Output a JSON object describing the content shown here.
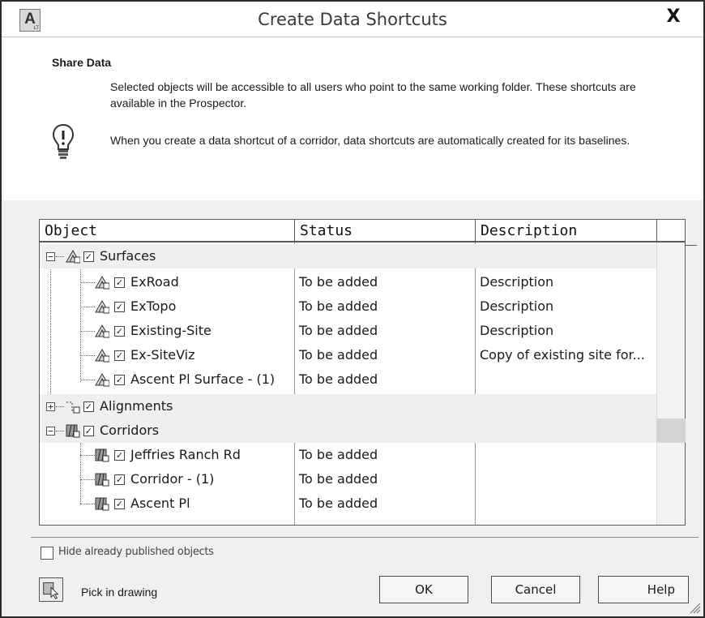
{
  "window": {
    "title": "Create Data Shortcuts",
    "close_label": "X",
    "app_icon_letter": "A",
    "app_icon_sub": "LT"
  },
  "info": {
    "heading": "Share Data",
    "text1": "Selected objects will be accessible to all users who point to the same working folder. These shortcuts are available in the Prospector.",
    "text2": "When you create a data shortcut of a corridor, data shortcuts are automatically created for its baselines.",
    "icon": "lightbulb-icon"
  },
  "grid": {
    "columns": [
      "Object",
      "Status",
      "Description"
    ],
    "rows": [
      {
        "name": "Surfaces",
        "status": "",
        "description": "",
        "group": true,
        "checked": true,
        "icon": "surface-icon"
      },
      {
        "name": "ExRoad",
        "status": "To be added",
        "description": "Description",
        "group": false,
        "checked": true,
        "icon": "surface-icon"
      },
      {
        "name": "ExTopo",
        "status": "To be added",
        "description": "Description",
        "group": false,
        "checked": true,
        "icon": "surface-icon"
      },
      {
        "name": "Existing-Site",
        "status": "To be added",
        "description": "Description",
        "group": false,
        "checked": true,
        "icon": "surface-icon"
      },
      {
        "name": "Ex-SiteViz",
        "status": "To be added",
        "description": "Copy of existing site for...",
        "group": false,
        "checked": true,
        "icon": "surface-icon"
      },
      {
        "name": "Ascent Pl Surface - (1)",
        "status": "To be added",
        "description": "",
        "group": false,
        "checked": true,
        "icon": "surface-icon"
      },
      {
        "name": "Alignments",
        "status": "",
        "description": "",
        "group": true,
        "checked": true,
        "icon": "alignment-icon"
      },
      {
        "name": "Corridors",
        "status": "",
        "description": "",
        "group": true,
        "checked": true,
        "icon": "corridor-icon"
      },
      {
        "name": "Jeffries Ranch Rd",
        "status": "To be added",
        "description": "",
        "group": false,
        "checked": true,
        "icon": "corridor-icon"
      },
      {
        "name": "Corridor - (1)",
        "status": "To be added",
        "description": "",
        "group": false,
        "checked": true,
        "icon": "corridor-icon"
      },
      {
        "name": "Ascent Pl",
        "status": "To be added",
        "description": "",
        "group": false,
        "checked": true,
        "icon": "corridor-icon"
      }
    ]
  },
  "options": {
    "hide_published_label": "Hide already published objects",
    "hide_published_checked": false
  },
  "footer": {
    "pick_label": "Pick in drawing",
    "ok_label": "OK",
    "cancel_label": "Cancel",
    "help_label": "Help"
  }
}
